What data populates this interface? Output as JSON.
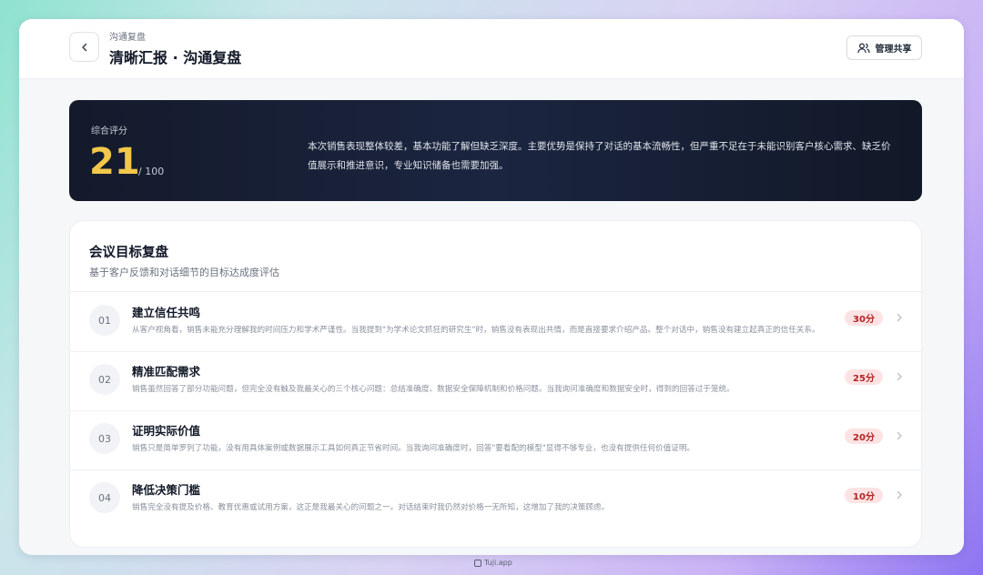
{
  "header": {
    "breadcrumb": "沟通复盘",
    "title": "清晰汇报 · 沟通复盘",
    "share_label": "管理共享"
  },
  "score": {
    "label": "综合评分",
    "value": "21",
    "max": "/ 100",
    "summary": "本次销售表现整体较差，基本功能了解但缺乏深度。主要优势是保持了对话的基本流畅性，但严重不足在于未能识别客户核心需求、缺乏价值展示和推进意识，专业知识储备也需要加强。"
  },
  "goals": {
    "title": "会议目标复盘",
    "subtitle": "基于客户反馈和对话细节的目标达成度评估",
    "items": [
      {
        "num": "01",
        "title": "建立信任共鸣",
        "desc": "从客户视角看，销售未能充分理解我的时间压力和学术严谨性。当我提到\"为学术论文抓狂的研究生\"时，销售没有表现出共情，而是直接要求介绍产品。整个对话中，销售没有建立起真正的信任关系。",
        "score": "30分"
      },
      {
        "num": "02",
        "title": "精准匹配需求",
        "desc": "销售虽然回答了部分功能问题，但完全没有触及我最关心的三个核心问题：总结准确度、数据安全保障机制和价格问题。当我询问准确度和数据安全时，得到的回答过于笼统。",
        "score": "25分"
      },
      {
        "num": "03",
        "title": "证明实际价值",
        "desc": "销售只是简单罗列了功能，没有用具体案例或数据展示工具如何真正节省时间。当我询问准确度时，回答\"要看配的模型\"显得不够专业，也没有提供任何价值证明。",
        "score": "20分"
      },
      {
        "num": "04",
        "title": "降低决策门槛",
        "desc": "销售完全没有提及价格、教育优惠或试用方案，这正是我最关心的问题之一。对话结束时我仍然对价格一无所知，这增加了我的决策顾虑。",
        "score": "10分"
      }
    ]
  },
  "footer": {
    "brand": "Tuji.app"
  },
  "colors": {
    "score_accent": "#f4c74a",
    "badge_bg": "#fde3e3",
    "badge_text": "#b42323"
  }
}
